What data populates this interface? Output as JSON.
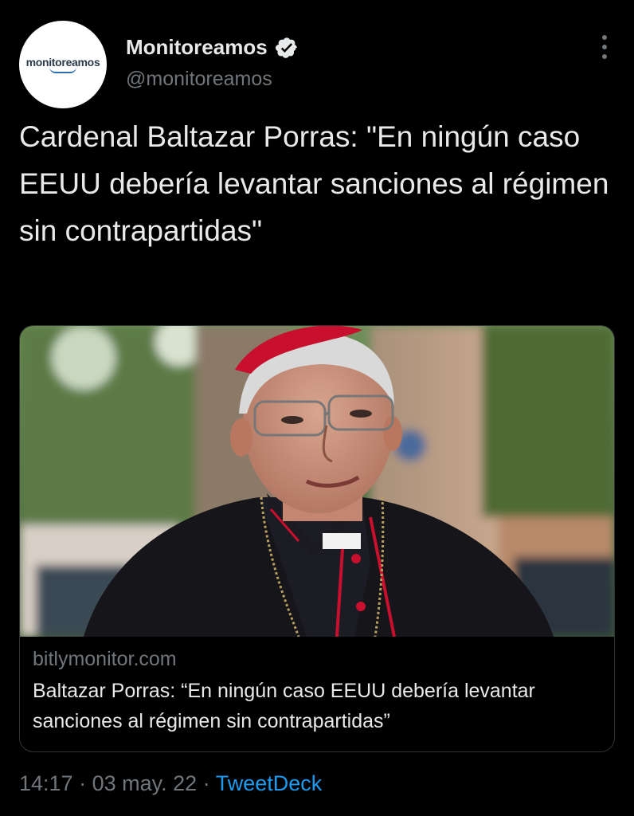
{
  "account": {
    "display_name": "Monitoreamos",
    "handle": "@monitoreamos",
    "avatar_logo_text": "monitoreamos",
    "verified": true
  },
  "tweet": {
    "text": "Cardenal Baltazar Porras: \"En ningún caso EEUU debería levantar sanciones al régimen sin contrapartidas\""
  },
  "card": {
    "domain": "bitlymonitor.com",
    "title": "Baltazar Porras: “En ningún caso EEUU debería levantar sanciones al régimen sin contrapartidas”"
  },
  "footer": {
    "time": "14:17",
    "separator": "·",
    "date": "03 may. 22",
    "source": "TweetDeck"
  },
  "colors": {
    "background": "#000000",
    "primary_text": "#e7e9ea",
    "secondary_text": "#71767b",
    "link": "#1d9bf0",
    "zucchetto_red": "#c8102e"
  },
  "icons": [
    "verified-badge-icon",
    "more-options-icon"
  ]
}
